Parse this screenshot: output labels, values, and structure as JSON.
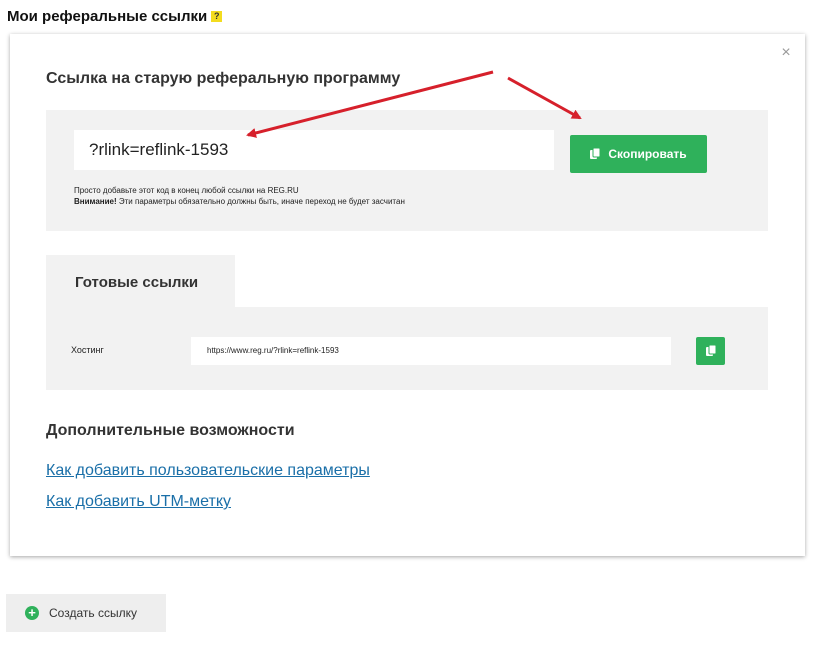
{
  "page": {
    "title": "Мои реферальные ссылки",
    "help_badge": "?"
  },
  "old_program": {
    "title": "Ссылка на старую реферальную программу",
    "link_value": "?rlink=reflink-1593",
    "copy_button_label": "Скопировать",
    "hint_line1": "Просто добавьте этот код в конец любой ссылки на REG.RU",
    "hint_warning_label": "Внимание!",
    "hint_warning_text": " Эти параметры обязательно должны быть, иначе переход не будет засчитан"
  },
  "ready_links": {
    "tab_label": "Готовые ссылки",
    "rows": [
      {
        "label": "Хостинг",
        "url": "https://www.reg.ru/?rlink=reflink-1593"
      }
    ]
  },
  "extra": {
    "title": "Дополнительные возможности",
    "links": [
      "Как добавить пользовательские параметры",
      "Как добавить UTM-метку"
    ]
  },
  "create_button_label": "Создать ссылку",
  "colors": {
    "accent_green": "#2fb15b",
    "link_blue": "#1a6fa8",
    "annotation_red": "#d6202b",
    "panel_gray": "#f2f2f2"
  },
  "icons": {
    "close": "close-icon",
    "copy": "copy-icon",
    "plus": "plus-circle-icon"
  }
}
